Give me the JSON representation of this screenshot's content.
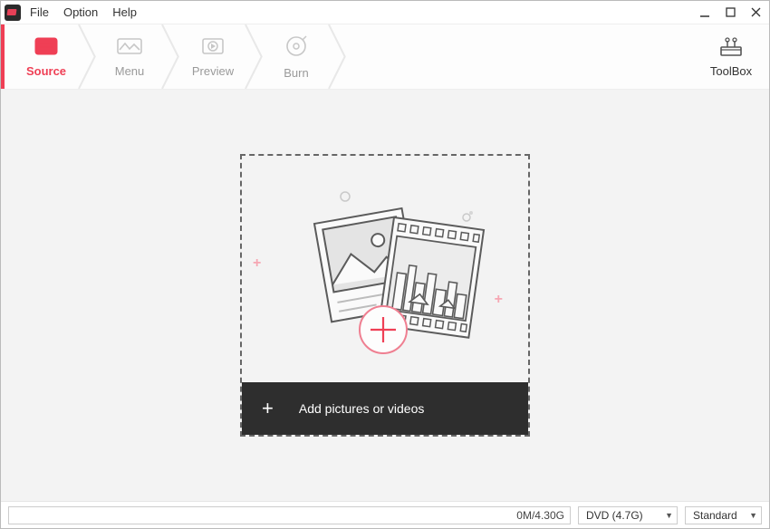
{
  "menubar": {
    "items": [
      "File",
      "Option",
      "Help"
    ]
  },
  "steps": [
    {
      "id": "source",
      "label": "Source",
      "active": true
    },
    {
      "id": "menu",
      "label": "Menu",
      "active": false
    },
    {
      "id": "preview",
      "label": "Preview",
      "active": false
    },
    {
      "id": "burn",
      "label": "Burn",
      "active": false
    }
  ],
  "toolbox": {
    "label": "ToolBox"
  },
  "dropzone": {
    "label": "Add pictures or videos"
  },
  "status": {
    "progress_text": "0M/4.30G",
    "disc_select": "DVD (4.7G)",
    "quality_select": "Standard"
  },
  "colors": {
    "accent": "#ef3f55"
  }
}
